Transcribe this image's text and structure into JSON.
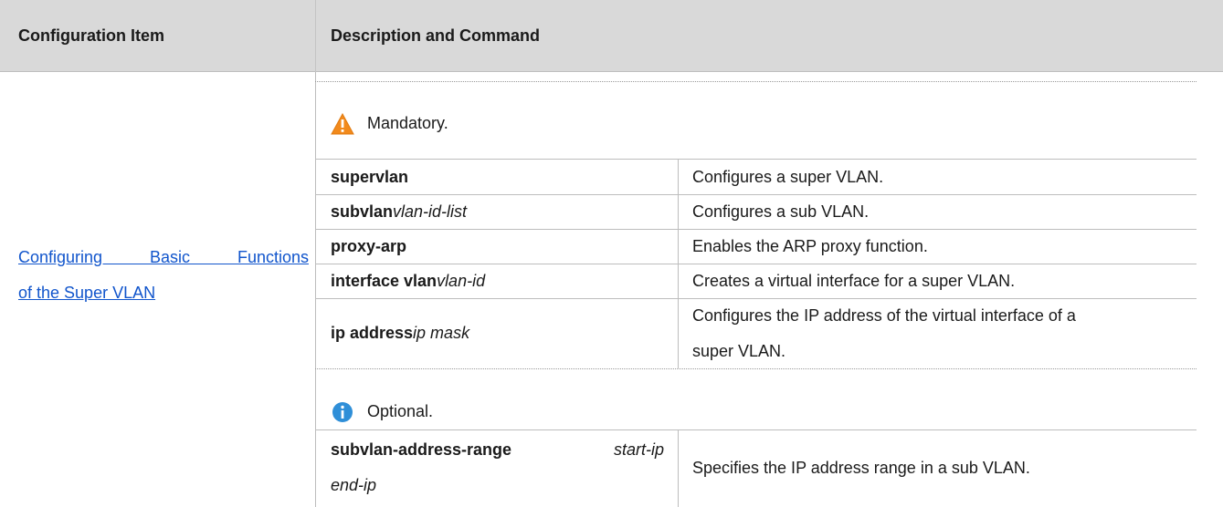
{
  "table": {
    "headers": {
      "item": "Configuration Item",
      "description": "Description and Command"
    },
    "item_link": {
      "line1": "Configuring Basic Functions",
      "line2": "of the Super VLAN"
    },
    "sections": [
      {
        "note": "Mandatory.",
        "note_icon": "warning-icon",
        "rows": [
          {
            "command": "supervlan",
            "args": "",
            "description": "Configures a super VLAN."
          },
          {
            "command": "subvlan",
            "args": "vlan-id-list",
            "description": "Configures a sub VLAN."
          },
          {
            "command": "proxy-arp",
            "args": "",
            "description": "Enables the ARP proxy function."
          },
          {
            "command": "interface vlan",
            "args": "vlan-id",
            "description": "Creates a virtual interface for a super VLAN."
          },
          {
            "command": "ip address",
            "args": "ip mask",
            "description_line1": "Configures the IP address of the virtual interface of a",
            "description_line2": "super VLAN."
          }
        ]
      },
      {
        "note": "Optional.",
        "note_icon": "info-icon",
        "rows": [
          {
            "command": "subvlan-address-range",
            "args1": "start-ip",
            "args2": "end-ip",
            "description": "Specifies the IP address range in a sub VLAN."
          }
        ]
      }
    ]
  },
  "colors": {
    "header_bg": "#d9d9d9",
    "link": "#1155cc",
    "warning": "#f28a1c",
    "info": "#2f8fd8"
  }
}
